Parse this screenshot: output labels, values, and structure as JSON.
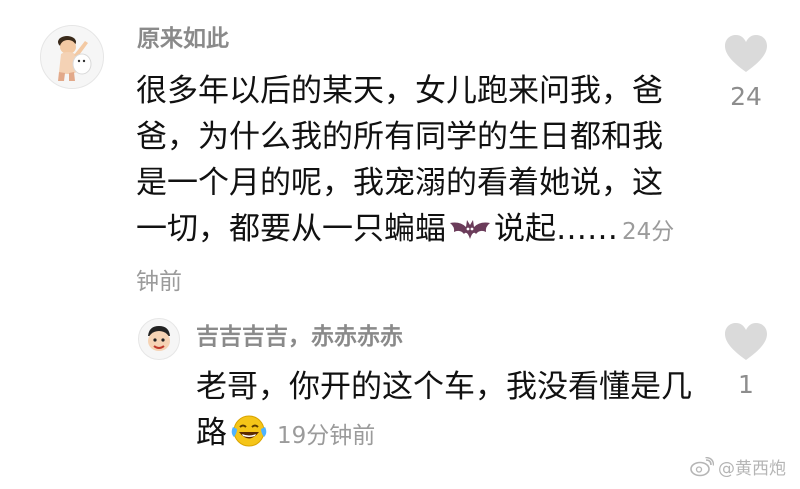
{
  "comment": {
    "author": "原来如此",
    "text": "很多年以后的某天，女儿跑来问我，爸爸，为什么我的所有同学的生日都和我是一个月的呢，我宠溺的看着她说，这一切，都要从一只蝙蝠",
    "text_end": "说起……",
    "time": "24分钟前",
    "likes": "24",
    "avatar_icon": "cartoon-character-avatar",
    "inline_emoji": "bat-emoji"
  },
  "reply": {
    "author": "吉吉吉吉，赤赤赤赤",
    "text": "老哥，你开的这个车，我没看懂是几路",
    "time": "19分钟前",
    "likes": "1",
    "avatar_icon": "cartoon-face-avatar",
    "inline_emoji": "laughing-crying-emoji"
  },
  "watermark": {
    "text": "@黄西炮",
    "icon": "weibo-logo"
  },
  "colors": {
    "username": "#8a8a8a",
    "body_text": "#111111",
    "time_text": "#9b9b9b",
    "like_icon": "#dadada",
    "like_count": "#8d8d8d"
  }
}
